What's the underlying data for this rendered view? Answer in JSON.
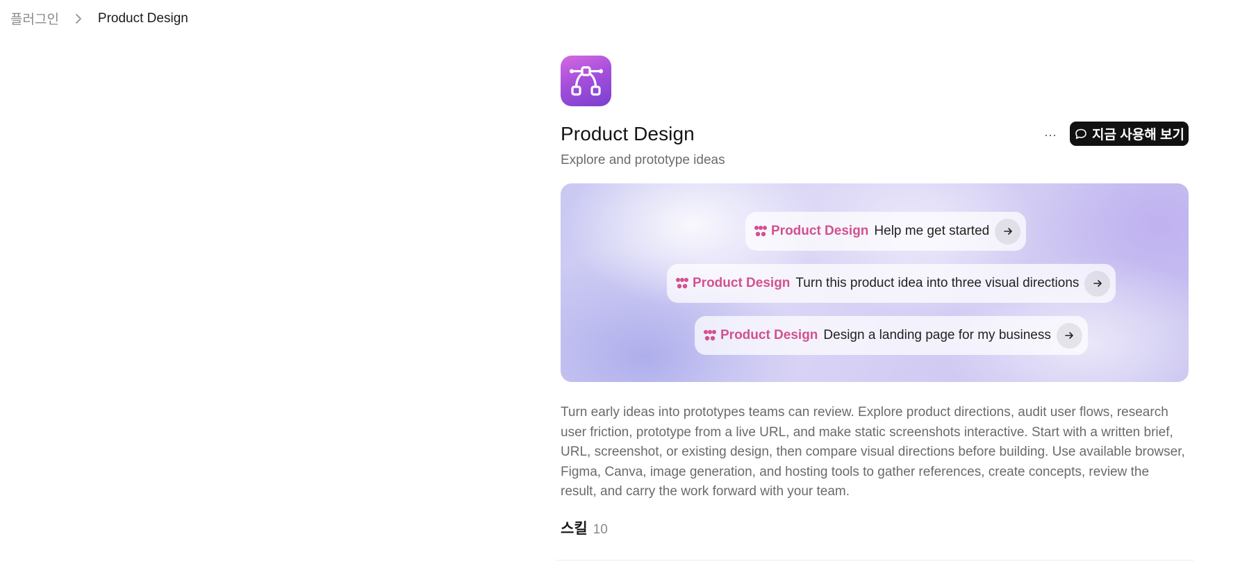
{
  "breadcrumb": {
    "parent": "플러그인",
    "current": "Product Design"
  },
  "plugin": {
    "title": "Product Design",
    "subtitle": "Explore and prototype ideas",
    "more_label": "···",
    "try_label": "지금 사용해 보기",
    "icon": "nodes-connector-icon"
  },
  "prompts": [
    {
      "brand": "Product Design",
      "text": "Help me get started"
    },
    {
      "brand": "Product Design",
      "text": "Turn this product idea into three visual directions"
    },
    {
      "brand": "Product Design",
      "text": "Design a landing page for my business"
    }
  ],
  "description": "Turn early ideas into prototypes teams can review. Explore product directions, audit user flows, research user friction, prototype from a live URL, and make static screenshots interactive. Start with a written brief, URL, screenshot, or existing design, then compare visual directions before building. Use available browser, Figma, Canva, image generation, and hosting tools to gather references, create concepts, review the result, and carry the work forward with your team.",
  "skills": {
    "label": "스킬",
    "count": "10"
  },
  "colors": {
    "brand_pink": "#d4508f",
    "icon_gradient_start": "#d56ae0",
    "icon_gradient_end": "#7a3fcf",
    "button_bg": "#111111"
  }
}
